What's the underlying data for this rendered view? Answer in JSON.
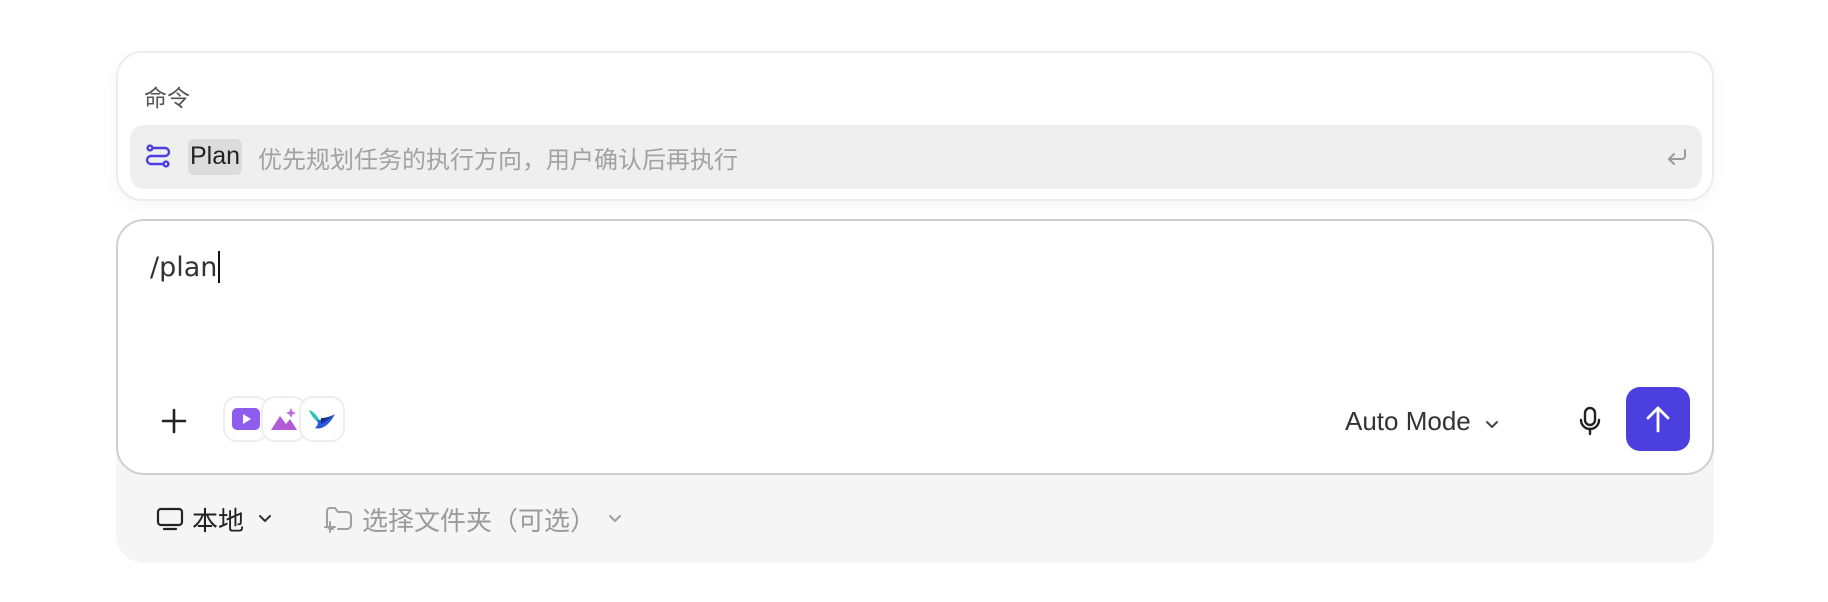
{
  "command_menu": {
    "header": "命令",
    "items": [
      {
        "name": "Plan",
        "description": "优先规划任务的执行方向，用户确认后再执行",
        "icon": "plan-flow-icon",
        "shortcut_icon": "enter-key-icon"
      }
    ]
  },
  "composer": {
    "input_value": "/plan",
    "add_icon": "plus-icon",
    "apps": [
      {
        "icon": "video-play-icon",
        "color": "#8f5cf0"
      },
      {
        "icon": "image-sparkle-icon",
        "color": "#b15bd6"
      },
      {
        "icon": "bird-logo-icon",
        "color": "#2a5ae0"
      }
    ],
    "mode_label": "Auto Mode",
    "mic_icon": "microphone-icon",
    "send_icon": "arrow-up-icon",
    "accent_color": "#4b3fe0"
  },
  "bottom_bar": {
    "environment_label": "本地",
    "environment_icon": "monitor-icon",
    "folder_label": "选择文件夹（可选）",
    "folder_icon": "folder-add-icon"
  }
}
